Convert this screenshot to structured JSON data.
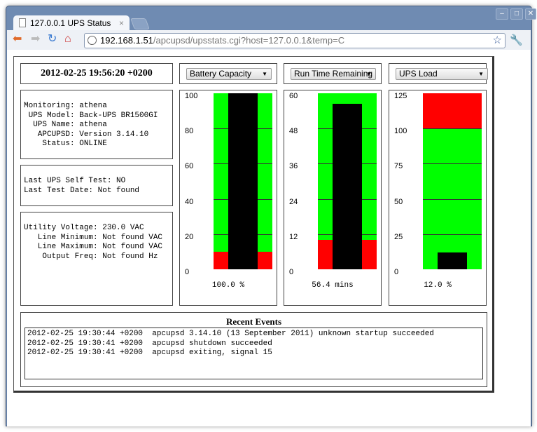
{
  "browser": {
    "tab_title": "127.0.0.1 UPS Status",
    "url_host": "192.168.1.51",
    "url_path": "/apcupsd/upsstats.cgi?host=127.0.0.1&temp=C"
  },
  "datetime": "2012-02-25 19:56:20 +0200",
  "info": [
    "Monitoring: athena",
    " UPS Model: Back-UPS BR1500GI",
    "  UPS Name: athena",
    "   APCUPSD: Version 3.14.10",
    "    Status: ONLINE"
  ],
  "selftest": [
    "Last UPS Self Test: NO",
    "Last Test Date: Not found"
  ],
  "voltage": [
    "Utility Voltage: 230.0 VAC",
    "   Line Minimum: Not found VAC",
    "   Line Maximum: Not found VAC",
    "    Output Freq: Not found Hz"
  ],
  "colors": {
    "green": "#00ff00",
    "red": "#ff0000",
    "bar": "#000000"
  },
  "gauges": [
    {
      "select": "Battery Capacity",
      "max": 100,
      "ticks": [
        "100",
        "80",
        "60",
        "40",
        "20",
        "0"
      ],
      "value": 100.0,
      "label": "100.0 %",
      "zones": [
        {
          "from": 0,
          "to": 10,
          "color": "red"
        },
        {
          "from": 10,
          "to": 100,
          "color": "green"
        }
      ]
    },
    {
      "select": "Run Time Remaining",
      "max": 60,
      "ticks": [
        "60",
        "48",
        "36",
        "24",
        "12",
        "0"
      ],
      "value": 56.4,
      "label": "56.4 mins",
      "zones": [
        {
          "from": 0,
          "to": 10,
          "color": "red"
        },
        {
          "from": 10,
          "to": 60,
          "color": "green"
        }
      ]
    },
    {
      "select": "UPS Load",
      "max": 125,
      "ticks": [
        "125",
        "100",
        "75",
        "50",
        "25",
        "0"
      ],
      "value": 12.0,
      "label": "12.0 %",
      "zones": [
        {
          "from": 0,
          "to": 100,
          "color": "green"
        },
        {
          "from": 100,
          "to": 125,
          "color": "red"
        }
      ]
    }
  ],
  "events": {
    "title": "Recent Events",
    "lines": [
      "2012-02-25 19:30:44 +0200  apcupsd 3.14.10 (13 September 2011) unknown startup succeeded",
      "2012-02-25 19:30:41 +0200  apcupsd shutdown succeeded",
      "2012-02-25 19:30:41 +0200  apcupsd exiting, signal 15"
    ]
  }
}
